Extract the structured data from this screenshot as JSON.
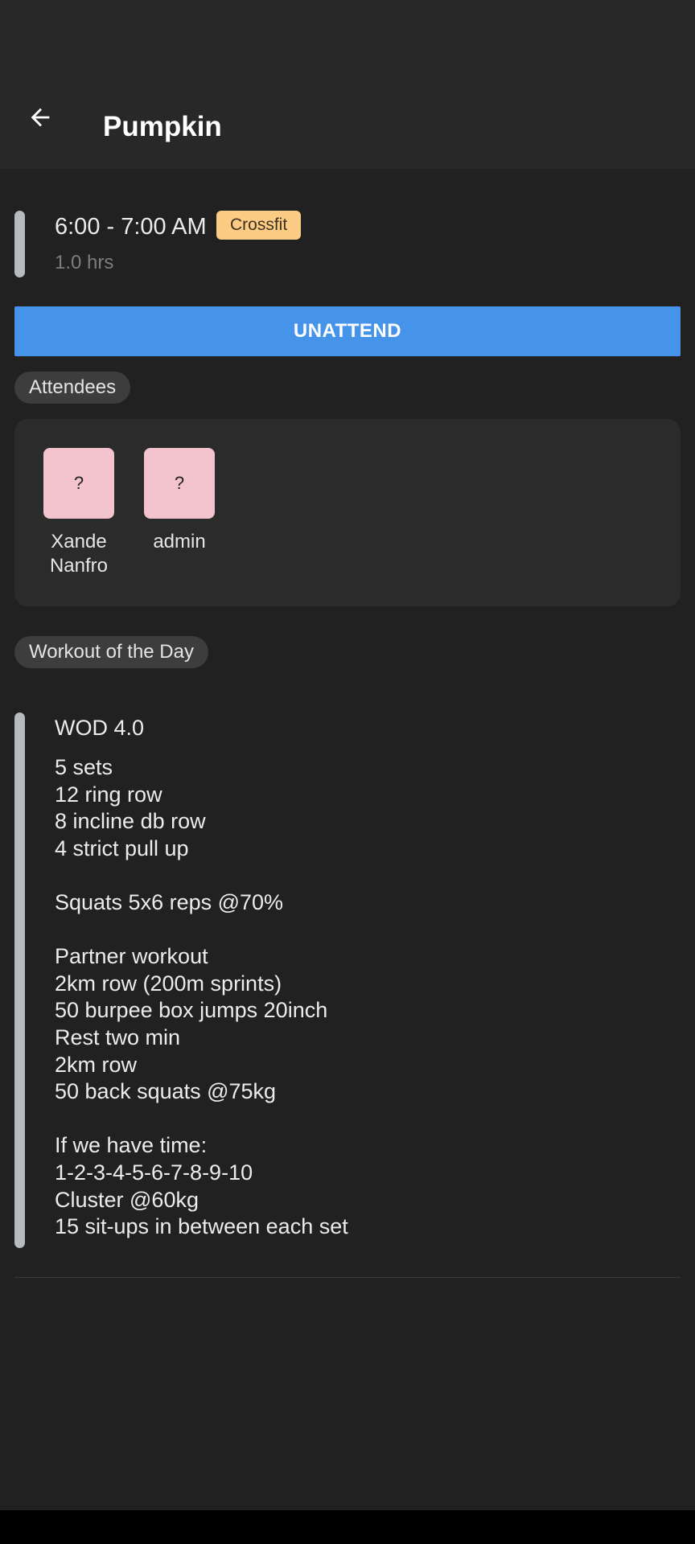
{
  "header": {
    "title": "Pumpkin"
  },
  "session": {
    "time": "6:00 - 7:00 AM",
    "class_type": "Crossfit",
    "duration": "1.0 hrs"
  },
  "actions": {
    "unattend_label": "UNATTEND"
  },
  "attendees": {
    "section_label": "Attendees",
    "people": [
      {
        "avatar_placeholder": "?",
        "name": "Xande Nanfro"
      },
      {
        "avatar_placeholder": "?",
        "name": "admin"
      }
    ]
  },
  "wod": {
    "section_label": "Workout of the Day",
    "title": "WOD 4.0",
    "description": "5 sets\n12 ring row\n8 incline db row\n4 strict pull up\n\nSquats 5x6 reps @70%\n\nPartner workout\n2km row (200m sprints)\n50 burpee box jumps 20inch\nRest two min\n2km row\n50 back squats @75kg\n\nIf we have time:\n1-2-3-4-5-6-7-8-9-10\nCluster @60kg\n15 sit-ups in between each set"
  },
  "colors": {
    "background": "#212121",
    "app_bar": "#282828",
    "accent_button": "#4594ea",
    "badge": "#fccc85",
    "avatar": "#f3c4cd",
    "indicator": "#b6bbbf"
  }
}
